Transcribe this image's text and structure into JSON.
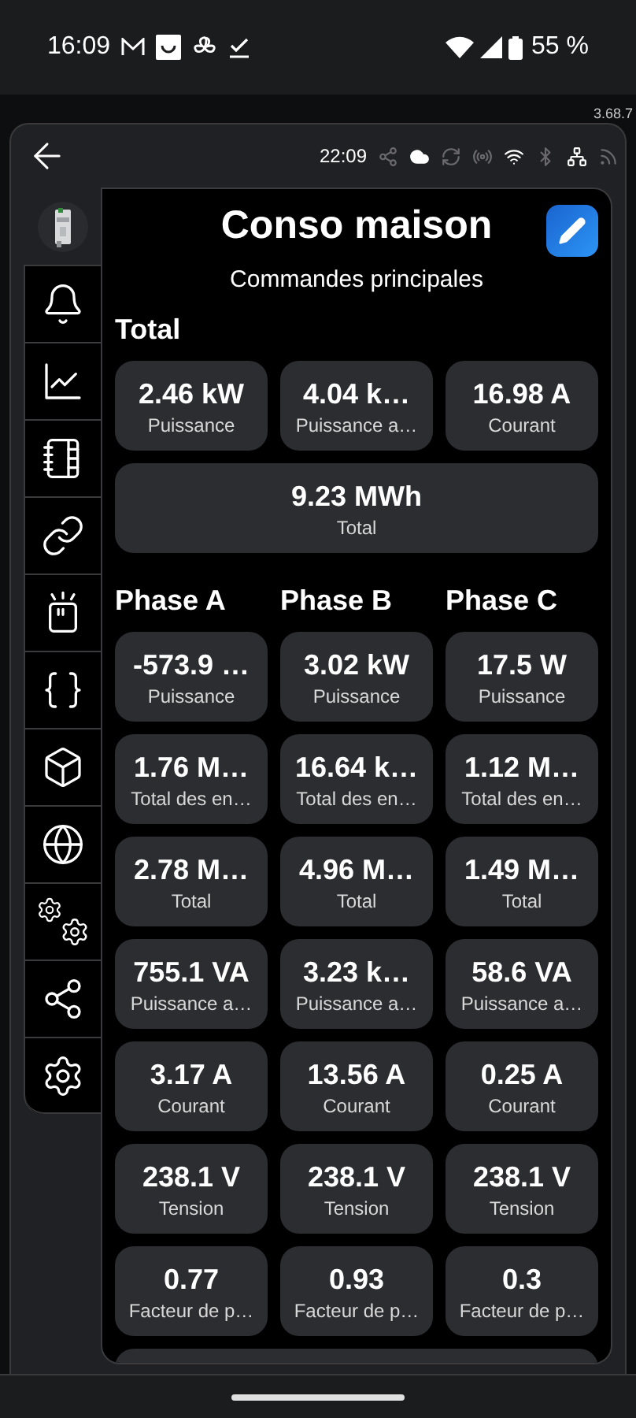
{
  "phone_status": {
    "time": "16:09",
    "battery": "55 %"
  },
  "version": "3.68.7",
  "header": {
    "time": "22:09",
    "status_icons": [
      {
        "kind": "share",
        "on": false
      },
      {
        "kind": "cloud",
        "on": true
      },
      {
        "kind": "sync",
        "on": false
      },
      {
        "kind": "radio",
        "on": false
      },
      {
        "kind": "wifi",
        "on": true
      },
      {
        "kind": "bluetooth",
        "on": false
      },
      {
        "kind": "network",
        "on": true
      },
      {
        "kind": "rss",
        "on": false
      }
    ]
  },
  "title": "Conso maison",
  "subtitle": "Commandes principales",
  "total": {
    "heading": "Total",
    "tiles": [
      {
        "value": "2.46 kW",
        "label": "Puissance",
        "wide": false
      },
      {
        "value": "4.04 k…",
        "label": "Puissance a…",
        "wide": false
      },
      {
        "value": "16.98 A",
        "label": "Courant",
        "wide": false
      },
      {
        "value": "9.23 MWh",
        "label": "Total",
        "wide": true
      }
    ]
  },
  "phases": {
    "headings": [
      "Phase A",
      "Phase B",
      "Phase C"
    ],
    "rows": [
      [
        {
          "value": "-573.9 …",
          "label": "Puissance"
        },
        {
          "value": "3.02 kW",
          "label": "Puissance"
        },
        {
          "value": "17.5 W",
          "label": "Puissance"
        }
      ],
      [
        {
          "value": "1.76 M…",
          "label": "Total des en…"
        },
        {
          "value": "16.64 k…",
          "label": "Total des en…"
        },
        {
          "value": "1.12 M…",
          "label": "Total des en…"
        }
      ],
      [
        {
          "value": "2.78 M…",
          "label": "Total"
        },
        {
          "value": "4.96 M…",
          "label": "Total"
        },
        {
          "value": "1.49 M…",
          "label": "Total"
        }
      ],
      [
        {
          "value": "755.1 VA",
          "label": "Puissance a…"
        },
        {
          "value": "3.23 k…",
          "label": "Puissance a…"
        },
        {
          "value": "58.6 VA",
          "label": "Puissance a…"
        }
      ],
      [
        {
          "value": "3.17 A",
          "label": "Courant"
        },
        {
          "value": "13.56 A",
          "label": "Courant"
        },
        {
          "value": "0.25 A",
          "label": "Courant"
        }
      ],
      [
        {
          "value": "238.1 V",
          "label": "Tension"
        },
        {
          "value": "238.1 V",
          "label": "Tension"
        },
        {
          "value": "238.1 V",
          "label": "Tension"
        }
      ],
      [
        {
          "value": "0.77",
          "label": "Facteur de p…"
        },
        {
          "value": "0.93",
          "label": "Facteur de p…"
        },
        {
          "value": "0.3",
          "label": "Facteur de p…"
        }
      ]
    ]
  }
}
